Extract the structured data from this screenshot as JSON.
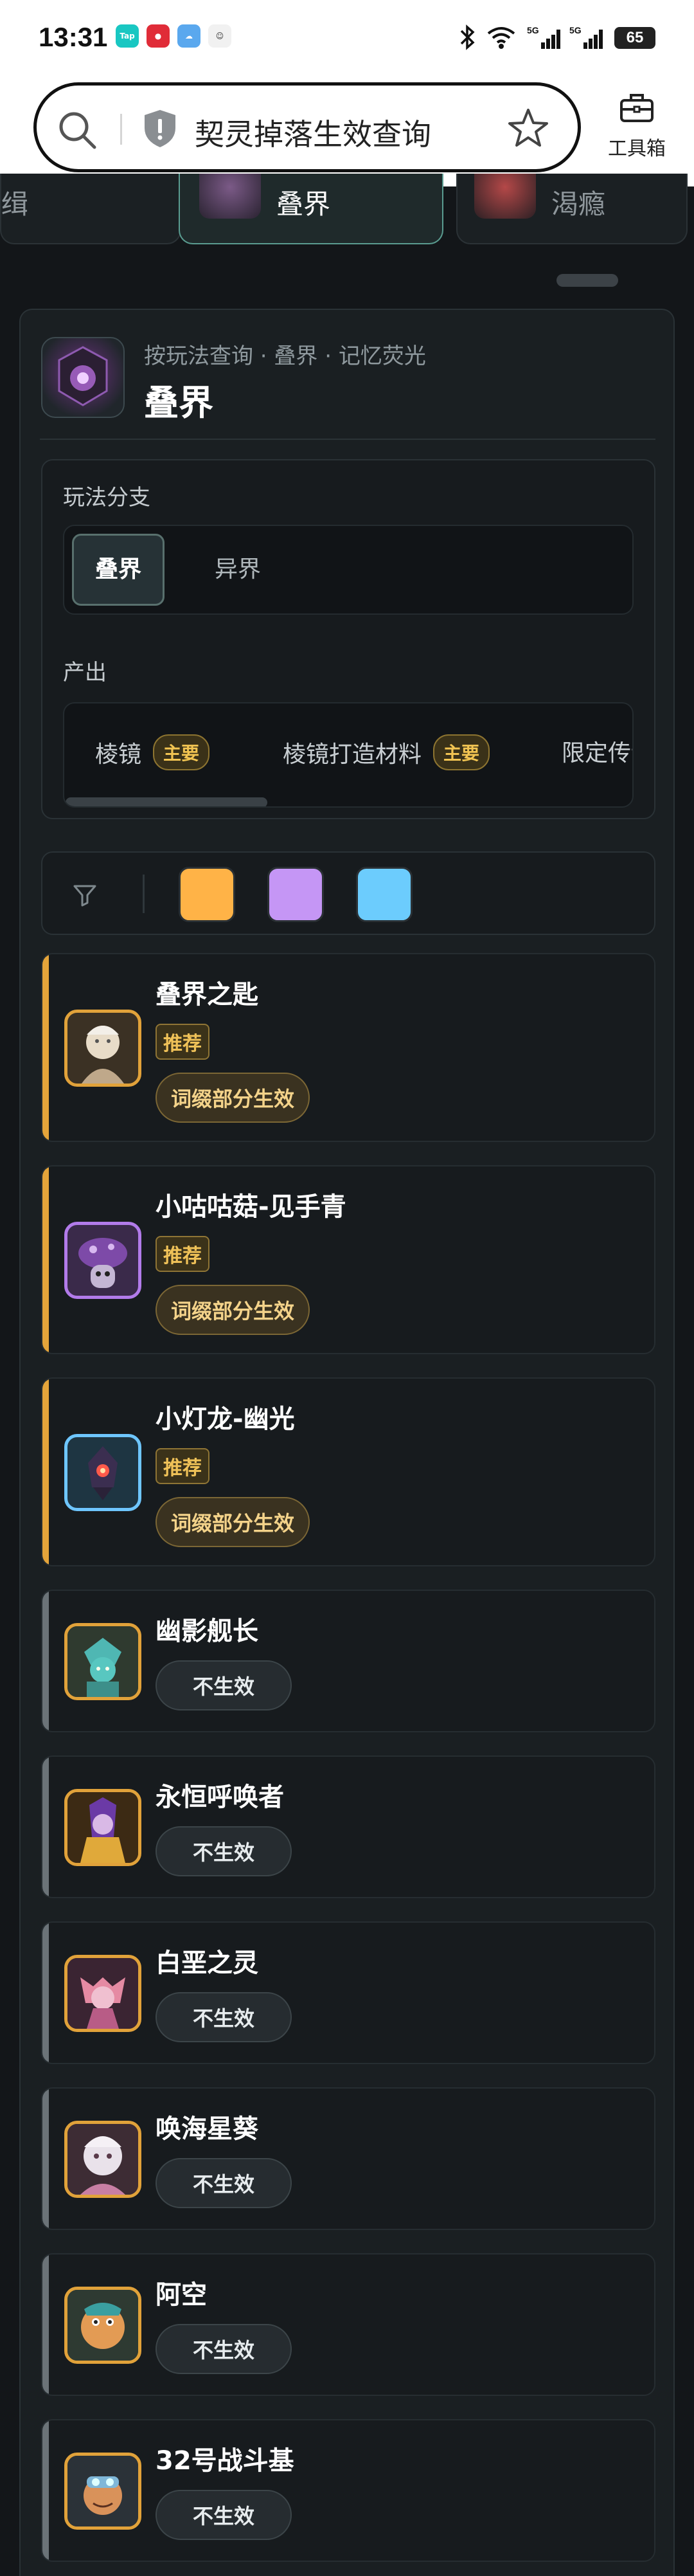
{
  "status": {
    "time": "13:31",
    "apps": [
      "TapTap",
      "app-red",
      "app-weather",
      "app-avatar"
    ],
    "battery": "65"
  },
  "header": {
    "query": "契灵掉落生效查询",
    "toolbox_label": "工具箱"
  },
  "top_tabs": [
    {
      "label": "缉"
    },
    {
      "label": "叠界"
    },
    {
      "label": "渴瘾"
    }
  ],
  "hero": {
    "subtitle": "按玩法查询 · 叠界 · 记忆荧光",
    "title": "叠界"
  },
  "filters": {
    "branch_label": "玩法分支",
    "branches": [
      "叠界",
      "异界"
    ],
    "output_label": "产出",
    "outputs": [
      {
        "label": "棱镜",
        "tag": "主要"
      },
      {
        "label": "棱镜打造材料",
        "tag": "主要"
      },
      {
        "label": "限定传说",
        "tag": ""
      }
    ]
  },
  "colors": [
    "#ffb347",
    "#c596f5",
    "#6cccfd"
  ],
  "items": [
    {
      "name": "叠界之匙",
      "rec": "推荐",
      "status": "词缀部分生效",
      "accent": "#e4a43a",
      "frame": "gold"
    },
    {
      "name": "小咕咕菇-见手青",
      "rec": "推荐",
      "status": "词缀部分生效",
      "accent": "#e4a43a",
      "frame": "purple"
    },
    {
      "name": "小灯龙-幽光",
      "rec": "推荐",
      "status": "词缀部分生效",
      "accent": "#e4a43a",
      "frame": "blue"
    },
    {
      "name": "幽影舰长",
      "status": "不生效",
      "accent": "#6b7378",
      "frame": "gold"
    },
    {
      "name": "永恒呼唤者",
      "status": "不生效",
      "accent": "#6b7378",
      "frame": "gold"
    },
    {
      "name": "白垩之灵",
      "status": "不生效",
      "accent": "#6b7378",
      "frame": "gold"
    },
    {
      "name": "唤海星葵",
      "status": "不生效",
      "accent": "#6b7378",
      "frame": "gold"
    },
    {
      "name": "阿空",
      "status": "不生效",
      "accent": "#6b7378",
      "frame": "gold"
    },
    {
      "name": "32号战斗基",
      "status": "不生效",
      "accent": "#6b7378",
      "frame": "gold"
    }
  ]
}
